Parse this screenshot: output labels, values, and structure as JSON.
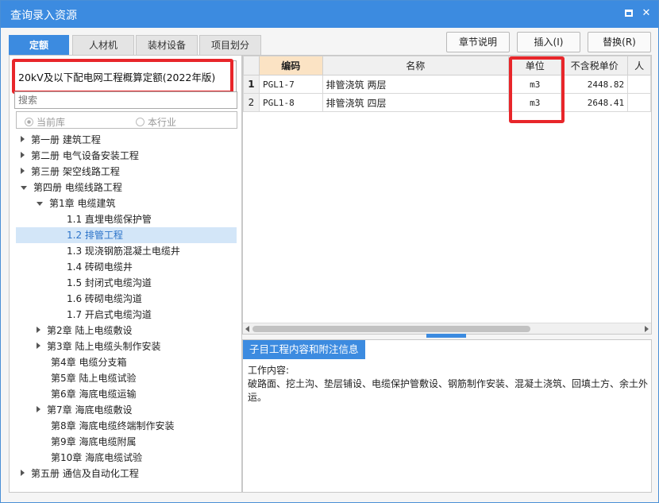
{
  "window": {
    "title": "查询录入资源"
  },
  "titlebar_buttons": {
    "restore_icon": "restore-icon",
    "close_glyph": "✕"
  },
  "tabs": [
    {
      "label": "定额",
      "active": true
    },
    {
      "label": "人材机",
      "active": false
    },
    {
      "label": "装材设备",
      "active": false
    },
    {
      "label": "项目划分",
      "active": false
    }
  ],
  "actions": {
    "chapter_notes": "章节说明",
    "insert": "插入(I)",
    "replace": "替换(R)"
  },
  "library": {
    "selected": "20kV及以下配电网工程概算定额(2022年版)"
  },
  "search": {
    "placeholder": "搜索"
  },
  "scope": {
    "current": "当前库",
    "industry": "本行业"
  },
  "tree": [
    {
      "label": "第一册 建筑工程",
      "arrow": "right"
    },
    {
      "label": "第二册 电气设备安装工程",
      "arrow": "right"
    },
    {
      "label": "第三册 架空线路工程",
      "arrow": "right"
    },
    {
      "label": "第四册 电缆线路工程",
      "arrow": "down"
    },
    {
      "label": "第1章 电缆建筑",
      "arrow": "down"
    },
    {
      "label": "1.1 直埋电缆保护管",
      "arrow": ""
    },
    {
      "label": "1.2 排管工程",
      "arrow": "",
      "selected": true
    },
    {
      "label": "1.3 现浇钢筋混凝土电缆井",
      "arrow": ""
    },
    {
      "label": "1.4 砖砌电缆井",
      "arrow": ""
    },
    {
      "label": "1.5 封闭式电缆沟道",
      "arrow": ""
    },
    {
      "label": "1.6 砖砌电缆沟道",
      "arrow": ""
    },
    {
      "label": "1.7 开启式电缆沟道",
      "arrow": ""
    },
    {
      "label": "第2章 陆上电缆敷设",
      "arrow": "right"
    },
    {
      "label": "第3章 陆上电缆头制作安装",
      "arrow": "right"
    },
    {
      "label": "第4章 电缆分支箱",
      "arrow": ""
    },
    {
      "label": "第5章 陆上电缆试验",
      "arrow": ""
    },
    {
      "label": "第6章 海底电缆运输",
      "arrow": ""
    },
    {
      "label": "第7章 海底电缆敷设",
      "arrow": "right"
    },
    {
      "label": "第8章 海底电缆终端制作安装",
      "arrow": ""
    },
    {
      "label": "第9章 海底电缆附属",
      "arrow": ""
    },
    {
      "label": "第10章 海底电缆试验",
      "arrow": ""
    },
    {
      "label": "第五册 通信及自动化工程",
      "arrow": "right"
    }
  ],
  "grid": {
    "headers": {
      "code": "编码",
      "name": "名称",
      "unit": "单位",
      "price": "不含税单价",
      "extra": "人"
    },
    "rows": [
      {
        "n": "1",
        "code": "PGL1-7",
        "name": "排管浇筑 两层",
        "unit": "m3",
        "price": "2448.82"
      },
      {
        "n": "2",
        "code": "PGL1-8",
        "name": "排管浇筑 四层",
        "unit": "m3",
        "price": "2648.41"
      }
    ]
  },
  "bottom": {
    "tab": "子目工程内容和附注信息",
    "heading": "工作内容:",
    "content": "破路面、挖土沟、垫层铺设、电缆保护管敷设、钢筋制作安装、混凝土浇筑、回填土方、余土外运。"
  }
}
